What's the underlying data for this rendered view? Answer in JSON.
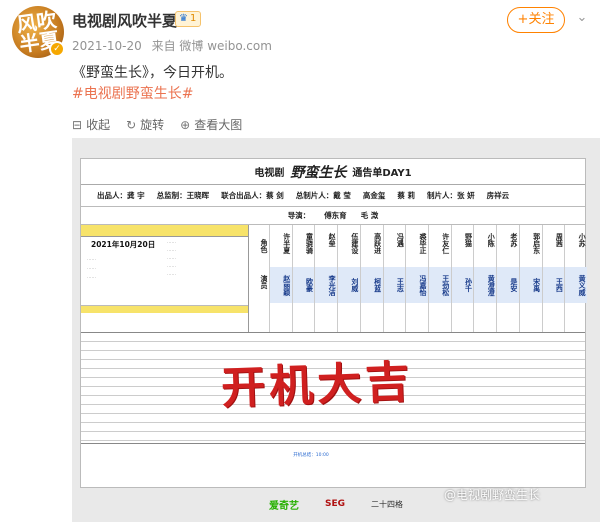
{
  "post": {
    "author": "电视剧风吹半夏",
    "avatar_text": "风吹半夏",
    "level": "1",
    "date": "2021-10-20",
    "source": "来自 微博 weibo.com",
    "text": "《野蛮生长》，今日开机。",
    "topic": "#电视剧野蛮生长#"
  },
  "actions": {
    "follow_label": "+关注",
    "collapse_label": "收起",
    "rotate_label": "旋转",
    "view_large_label": "查看大图"
  },
  "sheet": {
    "title_prefix": "电视剧",
    "brand": "野蛮生长",
    "title_suffix": "通告单DAY1",
    "producers_line": [
      "出品人：龚 宇",
      "总监制：王晓晖",
      "联合出品人：蔡 剑",
      "总制片人：戴 莹",
      "高金玺",
      "蔡 莉",
      "制片人：张 妍",
      "房祥云"
    ],
    "directors_line": [
      "导演：",
      "傅东育",
      "毛 溦"
    ],
    "date": "2021年10月20日",
    "role_label": "角色",
    "actor_label": "演员",
    "roles": [
      "许半夏",
      "童骁骑",
      "赵垒",
      "伍建设",
      "高跃进",
      "冯遇",
      "裘毕正",
      "许友仁",
      "野猫",
      "小陈",
      "老苏",
      "郭启东",
      "周茜",
      "小苏"
    ],
    "actors": [
      "赵丽颖",
      "欧豪",
      "李光洁",
      "刘威",
      "柯蓝",
      "王志",
      "冯嘉怡",
      "王劲松",
      "孙千",
      "黄澄澄",
      "是安",
      "宋禹",
      "王西",
      "黄义威"
    ],
    "stamp": "开机大吉",
    "footer_note": "开机总结：10:00",
    "logos": {
      "iqiyi": "爱奇艺",
      "seg": "SEG",
      "ershi": "二十四格"
    }
  },
  "watermark": "@电视剧野蛮生长"
}
